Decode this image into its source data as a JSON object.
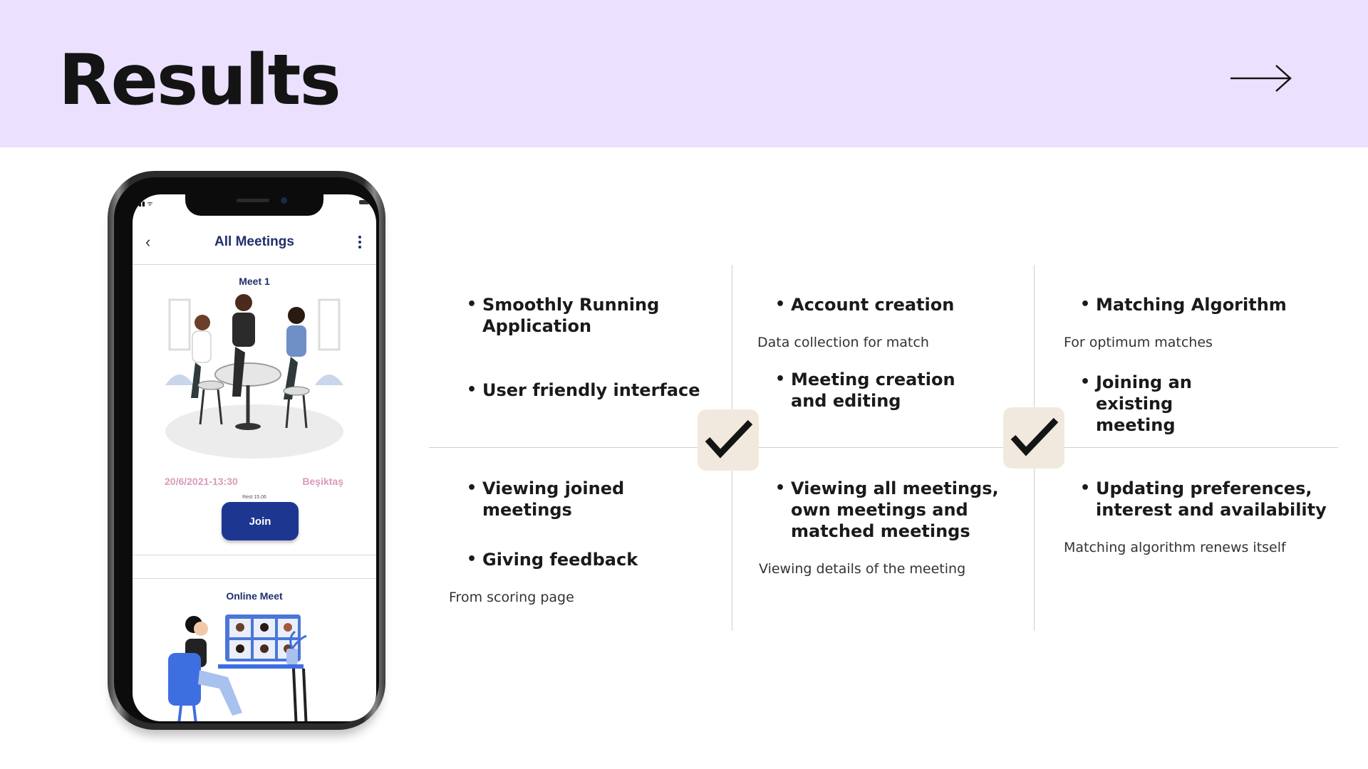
{
  "slide": {
    "title": "Results"
  },
  "phone": {
    "header_title": "All Meetings",
    "card1": {
      "name": "Meet 1",
      "date": "20/6/2021-13:30",
      "place": "Beşiktaş",
      "rest": "Rest 15.06",
      "join_label": "Join"
    },
    "card2": {
      "name": "Online Meet"
    }
  },
  "grid": {
    "cells": [
      {
        "bullets": [
          "Smoothly Running Application",
          "User friendly interface"
        ],
        "notes": []
      },
      {
        "bullets": [
          "Account creation",
          "Meeting creation and editing"
        ],
        "notes": [
          "Data collection for match"
        ]
      },
      {
        "bullets": [
          "Matching Algorithm",
          "Joining an existing meeting"
        ],
        "notes": [
          "For optimum matches"
        ]
      },
      {
        "bullets": [
          "Viewing joined meetings",
          "Giving feedback"
        ],
        "notes": [
          "From scoring page"
        ]
      },
      {
        "bullets": [
          "Viewing all meetings, own meetings and matched meetings"
        ],
        "notes": [
          "Viewing details of the meeting"
        ]
      },
      {
        "bullets": [
          "Updating preferences, interest and availability"
        ],
        "notes": [
          "Matching algorithm renews itself"
        ]
      }
    ]
  },
  "icons": {
    "next": "arrow-right-icon",
    "check": "checkmark-icon",
    "back": "chevron-left-icon",
    "menu": "kebab-menu-icon"
  },
  "colors": {
    "header_bg": "#ebe1fe",
    "check_bg": "#f1e9dd",
    "app_blue": "#1d3791",
    "date_pink": "#d89ab8"
  }
}
